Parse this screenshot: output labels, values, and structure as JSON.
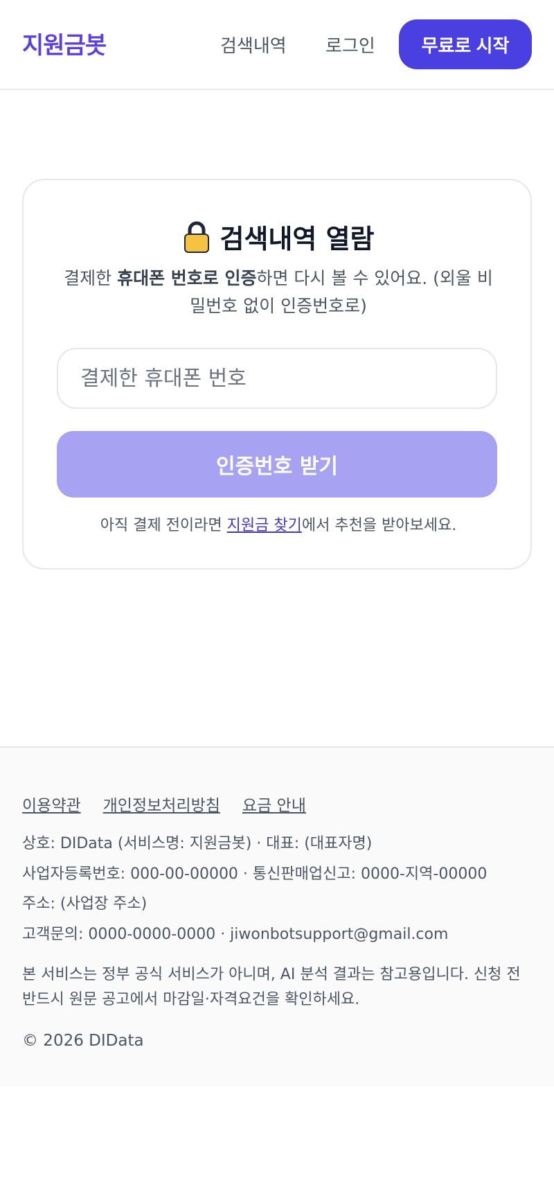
{
  "header": {
    "logo": "지원금봇",
    "nav_history": "검색내역",
    "nav_login": "로그인",
    "cta_label": "무료로 시작"
  },
  "card": {
    "title": "검색내역 열람",
    "icon": "lock-icon",
    "desc_prefix": "결제한 ",
    "desc_bold": "휴대폰 번호로 인증",
    "desc_suffix": "하면 다시 볼 수 있어요. (외울 비밀번호 없이 인증번호로)",
    "phone_placeholder": "결제한 휴대폰 번호",
    "phone_value": "",
    "otp_button": "인증번호 받기",
    "note_prefix": "아직 결제 전이라면 ",
    "note_link": "지원금 찾기",
    "note_suffix": "에서 추천을 받아보세요."
  },
  "footer": {
    "links": [
      "이용약관",
      "개인정보처리방침",
      "요금 안내"
    ],
    "company_line": "상호: DIData (서비스명: 지원금봇) · 대표: (대표자명)",
    "registration_line": "사업자등록번호: 000-00-00000 · 통신판매업신고: 0000-지역-00000",
    "address_line": "주소: (사업장 주소)",
    "contact_line": "고객문의: 0000-0000-0000 · jiwonbotsupport@gmail.com",
    "disclaimer": "본 서비스는 정부 공식 서비스가 아니며, AI 분석 결과는 참고용입니다. 신청 전 반드시 원문 공고에서 마감일·자격요건을 확인하세요.",
    "copyright": "© 2026 DIData"
  },
  "colors": {
    "brand": "#5b3fe0",
    "cta": "#4a3fe0",
    "button_disabled": "#a7a3f2",
    "lock": "#f5c242"
  }
}
